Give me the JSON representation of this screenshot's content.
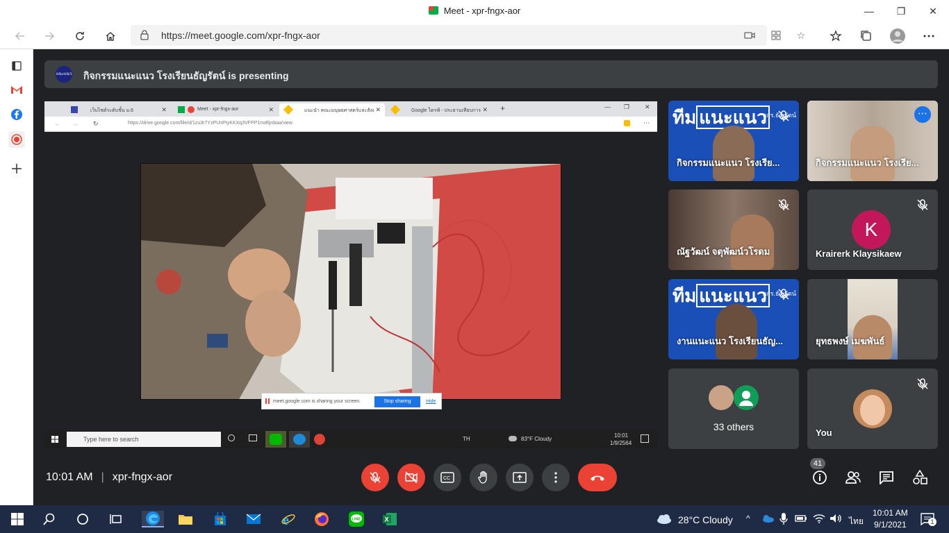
{
  "window": {
    "title": "Meet - xpr-fngx-aor",
    "minimize": "—",
    "restore": "❐",
    "close": "✕"
  },
  "browser": {
    "url": "https://meet.google.com/xpr-fngx-aor"
  },
  "meet": {
    "presenter_banner": "กิจกรรมแนะแนว โรงเรียนธัญรัตน์ is presenting",
    "presenter_logo_text": "แนะแนว",
    "time": "10:01 AM",
    "meeting_code": "xpr-fngx-aor",
    "participant_count": "41"
  },
  "shared_screen": {
    "tabs": [
      {
        "label": "เว็บไซต์ระดับชั้น ม.6"
      },
      {
        "label": "Meet - xpr-fngx-aor"
      },
      {
        "label": "แนะนำ คณะมนุษยศาสตร์และสังคมศาสตร์ มรภ..."
      },
      {
        "label": "Google ไดรฟ์ - ประธานเทียบการศก..."
      }
    ],
    "url": "https://drive.google.com/file/d/1zu3r7YzPUnPtyKKXq3VFPP1md6jnbaa/view",
    "sharing_message": "meet.google.com is sharing your screen.",
    "stop_sharing": "Stop sharing",
    "hide": "Hide",
    "taskbar_search": "Type here to search",
    "tray_lang": "TH",
    "tray_weather": "83°F  Cloudy",
    "tray_time": "10:01",
    "tray_date": "1/9/2564"
  },
  "participants": [
    {
      "name": "กิจกรรมแนะแนว โรงเรีย...",
      "banner_prefix": "ทีม",
      "banner_word": "แนะแนว",
      "badge": "นกร.ธัญรัตน์"
    },
    {
      "name": "กิจกรรมแนะแนว โรงเรีย..."
    },
    {
      "name": "ณัฐวัฒน์ จตุพัฒน์วโรดม"
    },
    {
      "name": "Krairerk Klaysikaew",
      "initial": "K"
    },
    {
      "name": "งานแนะแนว โรงเรียนธัญ...",
      "banner_prefix": "ทีม",
      "banner_word": "แนะแนว",
      "badge": "นกร.ธัญรัตน์"
    },
    {
      "name": "ยุทธพงษ์ เมฆพันธ์"
    },
    {
      "name": "33 others"
    },
    {
      "name": "You"
    }
  ],
  "colors": {
    "meet_bg": "#202124",
    "tile_bg": "#3c4043",
    "danger": "#ea4335",
    "accent": "#1a73e8"
  },
  "taskbar": {
    "weather": "28°C  Cloudy",
    "lang": "ไทย",
    "time": "10:01 AM",
    "date": "9/1/2021",
    "notification_count": "1"
  }
}
